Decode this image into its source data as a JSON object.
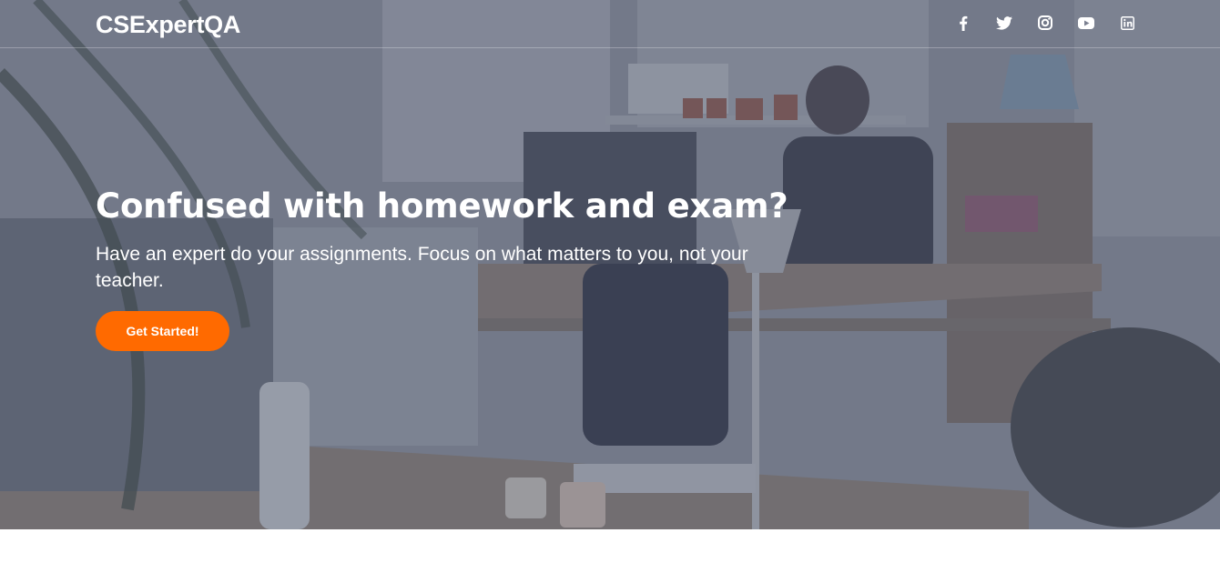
{
  "brand": {
    "name": "CSExpertQA"
  },
  "social": [
    {
      "icon": "facebook-icon"
    },
    {
      "icon": "twitter-icon"
    },
    {
      "icon": "instagram-icon"
    },
    {
      "icon": "youtube-icon"
    },
    {
      "icon": "linkedin-icon"
    }
  ],
  "hero": {
    "headline": "Confused with homework and exam?",
    "subtext": "Have an expert do your assignments. Focus on what matters to you, not your teacher.",
    "cta_label": "Get Started!"
  },
  "colors": {
    "accent": "#ff6a00",
    "overlay": "#464e64"
  }
}
